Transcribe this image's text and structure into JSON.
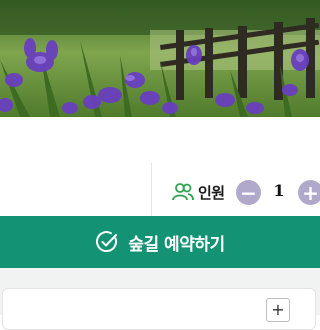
{
  "hero": {
    "image": "iris-flower-field-photo"
  },
  "headcount": {
    "icon": "people-icon",
    "label": "인원",
    "quantity": "1",
    "minus_symbol": "−",
    "plus_symbol": "+"
  },
  "reserve": {
    "icon": "check-circle-icon",
    "label": "숲길 예약하기"
  },
  "panel": {
    "expand_symbol": "+"
  },
  "colors": {
    "brand_green": "#139274",
    "stepper_purple": "#b0a9cc",
    "icon_green": "#2ea44f",
    "panel_bg": "#f1f2f2"
  }
}
